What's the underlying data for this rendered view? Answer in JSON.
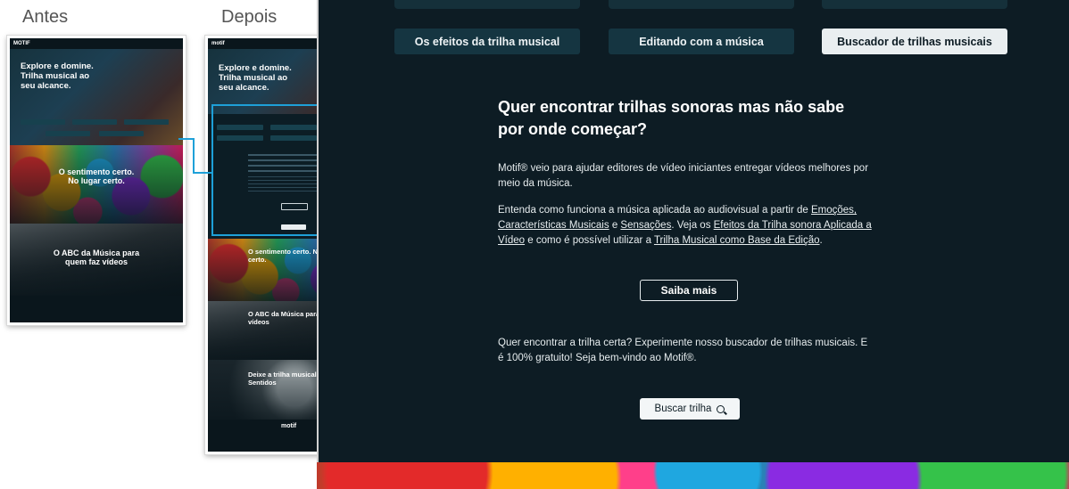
{
  "labels": {
    "before": "Antes",
    "after": "Depois"
  },
  "thumb_before": {
    "logo": "MOTIF",
    "hero": "Explore e domine.\nTrilha musical ao\nseu alcance.",
    "section1": "O sentimento certo.\nNo lugar certo.",
    "section2": "O ABC da Música para\nquem faz vídeos"
  },
  "thumb_after": {
    "logo": "motif",
    "hero": "Explore e domine.\nTrilha musical ao\nseu alcance.",
    "s1": "O sentimento certo. No lugar\ncerto.",
    "s2": "O ABC da Música para quem faz\nvídeos",
    "s3": "Deixe a trilha musical guiar seus\nSentidos",
    "footer_logo": "motif"
  },
  "tabs": [
    {
      "label": "Os efeitos da trilha musical",
      "active": false
    },
    {
      "label": "Editando com a música",
      "active": false
    },
    {
      "label": "Buscador de trilhas musicais",
      "active": true
    }
  ],
  "content": {
    "heading": "Quer encontrar trilhas sonoras mas não sabe por onde começar?",
    "p1": "Motif® veio para ajudar editores de vídeo iniciantes entregar vídeos melhores por meio da música.",
    "p2": {
      "t1": "Entenda como funciona a música aplicada ao audiovisual a partir de ",
      "l1": "Emoções, Características Musicais",
      "t2": " e ",
      "l2": "Sensações",
      "t3": ". Veja os ",
      "l3": "Efeitos da Trilha sonora Aplicada a Vídeo",
      "t4": " e como é possível utilizar a ",
      "l4": "Trilha Musical como Base da Edição",
      "t5": "."
    },
    "learn_more": "Saiba mais",
    "p3": "Quer encontrar a trilha certa? Experimente nosso buscador de trilhas musicais. E é 100% gratuito! Seja bem-vindo ao Motif®.",
    "search_button": "Buscar trilha"
  },
  "colors": {
    "background": "#0d1c24",
    "tab": "#153541",
    "active_tab": "#e9eef0",
    "accent": "#1ea0d8"
  }
}
